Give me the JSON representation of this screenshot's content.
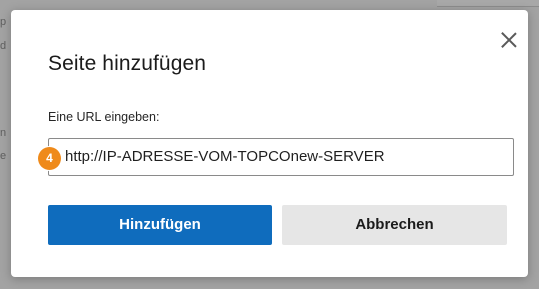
{
  "background": {
    "left_fragments": [
      "p",
      "d",
      "n",
      "e"
    ]
  },
  "dialog": {
    "title": "Seite hinzufügen",
    "close_icon": "close-icon",
    "url_label": "Eine URL eingeben:",
    "url_value": "http://IP-ADRESSE-VOM-TOPCOnew-SERVER",
    "step_badge": "4",
    "primary_button": "Hinzufügen",
    "secondary_button": "Abbrechen"
  },
  "colors": {
    "primary_button": "#0f6cbd",
    "secondary_button": "#e6e6e6",
    "step_badge": "#ef8a1a",
    "overlay": "#a3a3a3"
  }
}
